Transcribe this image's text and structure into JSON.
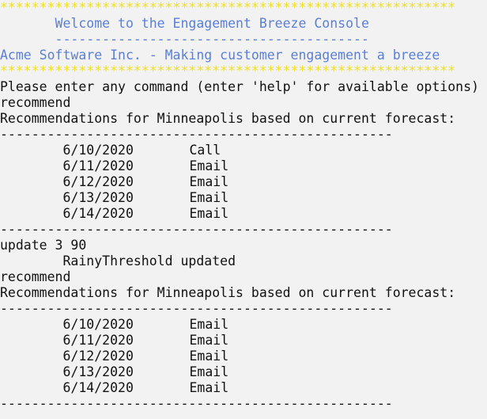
{
  "colors": {
    "background": "#f2f2f2",
    "text": "#111111",
    "banner": "#f0e01e",
    "title": "#5b7fd6"
  },
  "banner_line": "**********************************************************",
  "header": {
    "title": "       Welcome to the Engagement Breeze Console",
    "underline": "       ----------------------------------------",
    "tagline": "Acme Software Inc. - Making customer engagement a breeze"
  },
  "prompt": "Please enter any command (enter 'help' for available options)",
  "divider": "--------------------------------------------------",
  "session": {
    "cmd1": "recommend",
    "heading1": "Recommendations for Minneapolis based on current forecast:",
    "rows1": [
      {
        "date": "6/10/2020",
        "action": "Call"
      },
      {
        "date": "6/11/2020",
        "action": "Email"
      },
      {
        "date": "6/12/2020",
        "action": "Email"
      },
      {
        "date": "6/13/2020",
        "action": "Email"
      },
      {
        "date": "6/14/2020",
        "action": "Email"
      }
    ],
    "cmd2": "update 3 90",
    "update_msg": "        RainyThreshold updated",
    "cmd3": "recommend",
    "heading2": "Recommendations for Minneapolis based on current forecast:",
    "rows2": [
      {
        "date": "6/10/2020",
        "action": "Email"
      },
      {
        "date": "6/11/2020",
        "action": "Email"
      },
      {
        "date": "6/12/2020",
        "action": "Email"
      },
      {
        "date": "6/13/2020",
        "action": "Email"
      },
      {
        "date": "6/14/2020",
        "action": "Email"
      }
    ]
  }
}
